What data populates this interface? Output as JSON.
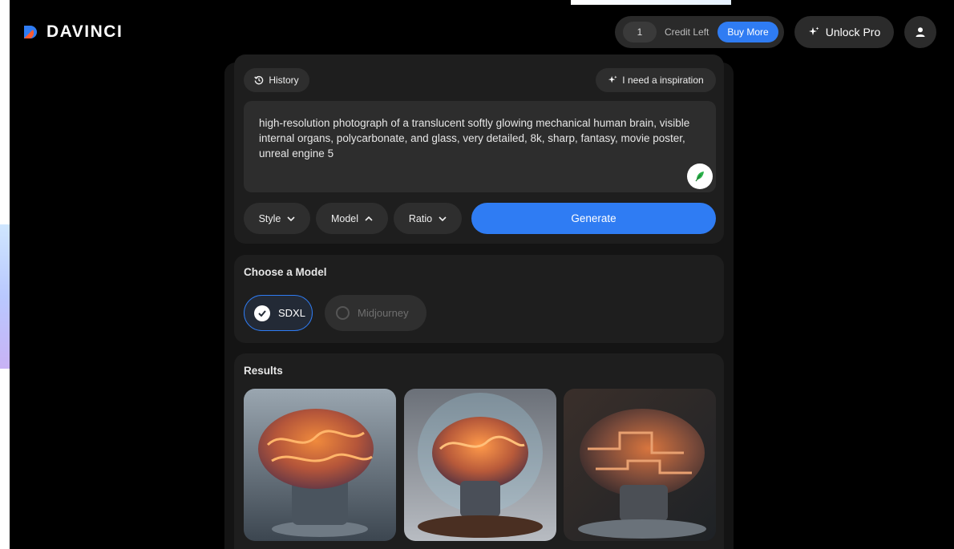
{
  "header": {
    "brand": "DAVINCI",
    "credits_count": "1",
    "credits_label": "Credit Left",
    "buy_more_label": "Buy More",
    "unlock_pro_label": "Unlock Pro",
    "accent_color": "#2f7cf3"
  },
  "prompt_card": {
    "history_label": "History",
    "inspiration_label": "I need a inspiration",
    "prompt_text": "high-resolution photograph of a translucent softly glowing mechanical human brain, visible internal organs, polycarbonate, and glass, very detailed, 8k, sharp, fantasy, movie poster, unreal engine 5",
    "options": {
      "style_label": "Style",
      "model_label": "Model",
      "ratio_label": "Ratio"
    },
    "generate_label": "Generate"
  },
  "model_card": {
    "title": "Choose a Model",
    "models": [
      {
        "label": "SDXL",
        "selected": true
      },
      {
        "label": "Midjourney",
        "selected": false
      }
    ]
  },
  "results_card": {
    "title": "Results",
    "images": [
      {
        "name": "result-image-1",
        "icon": "brain-render"
      },
      {
        "name": "result-image-2",
        "icon": "brain-dome-render"
      },
      {
        "name": "result-image-3",
        "icon": "brain-mechanical-render"
      }
    ]
  }
}
